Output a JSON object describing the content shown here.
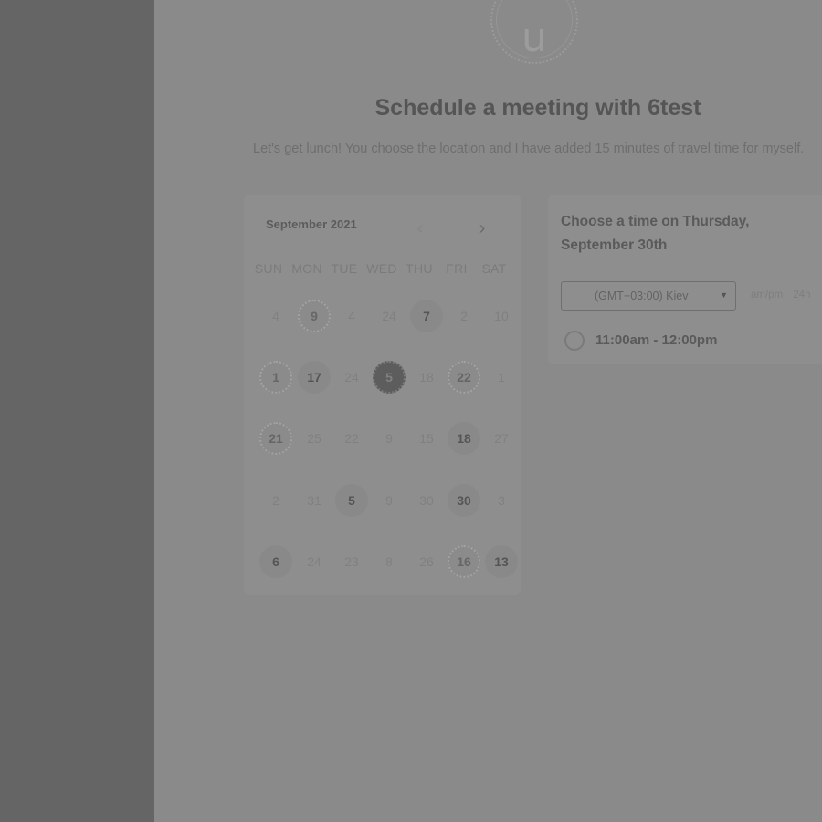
{
  "avatar": {
    "letter": "u"
  },
  "header": {
    "title": "Schedule a meeting with 6test",
    "subtitle": "Let's get lunch! You choose the location and I have added 15 minutes of travel time for myself."
  },
  "calendar": {
    "month_label": "September 2021",
    "prev_icon": "chevron-left-icon",
    "next_icon": "chevron-right-icon",
    "weekdays": [
      "SUN",
      "MON",
      "TUE",
      "WED",
      "THU",
      "FRI",
      "SAT"
    ],
    "weeks": [
      [
        {
          "label": "4",
          "state": "disabled"
        },
        {
          "label": "9",
          "state": "pattern"
        },
        {
          "label": "4",
          "state": "disabled"
        },
        {
          "label": "24",
          "state": "disabled"
        },
        {
          "label": "7",
          "state": "available"
        },
        {
          "label": "2",
          "state": "disabled"
        },
        {
          "label": "10",
          "state": "disabled"
        }
      ],
      [
        {
          "label": "1",
          "state": "pattern"
        },
        {
          "label": "17",
          "state": "available"
        },
        {
          "label": "24",
          "state": "disabled"
        },
        {
          "label": "5",
          "state": "selected"
        },
        {
          "label": "18",
          "state": "disabled"
        },
        {
          "label": "22",
          "state": "pattern"
        },
        {
          "label": "1",
          "state": "disabled"
        }
      ],
      [
        {
          "label": "21",
          "state": "pattern"
        },
        {
          "label": "25",
          "state": "disabled"
        },
        {
          "label": "22",
          "state": "disabled"
        },
        {
          "label": "9",
          "state": "disabled"
        },
        {
          "label": "15",
          "state": "disabled"
        },
        {
          "label": "18",
          "state": "available"
        },
        {
          "label": "27",
          "state": "disabled"
        }
      ],
      [
        {
          "label": "2",
          "state": "disabled"
        },
        {
          "label": "31",
          "state": "disabled"
        },
        {
          "label": "5",
          "state": "available"
        },
        {
          "label": "9",
          "state": "disabled"
        },
        {
          "label": "30",
          "state": "disabled"
        },
        {
          "label": "30",
          "state": "available"
        },
        {
          "label": "3",
          "state": "disabled"
        }
      ],
      [
        {
          "label": "6",
          "state": "available"
        },
        {
          "label": "24",
          "state": "disabled"
        },
        {
          "label": "23",
          "state": "disabled"
        },
        {
          "label": "8",
          "state": "disabled"
        },
        {
          "label": "26",
          "state": "disabled"
        },
        {
          "label": "16",
          "state": "pattern"
        },
        {
          "label": "13",
          "state": "available"
        }
      ]
    ]
  },
  "time_panel": {
    "title": "Choose a time on Thursday, September 30th",
    "timezone": "(GMT+03:00) Kiev",
    "format_options": [
      "am/pm",
      "24h"
    ],
    "slots": [
      "11:00am - 12:00pm"
    ]
  },
  "colors": {
    "overlay_bg": "#8a8a8a",
    "sidebar_bg": "#656565",
    "selected_day": "#5d5d5d"
  }
}
